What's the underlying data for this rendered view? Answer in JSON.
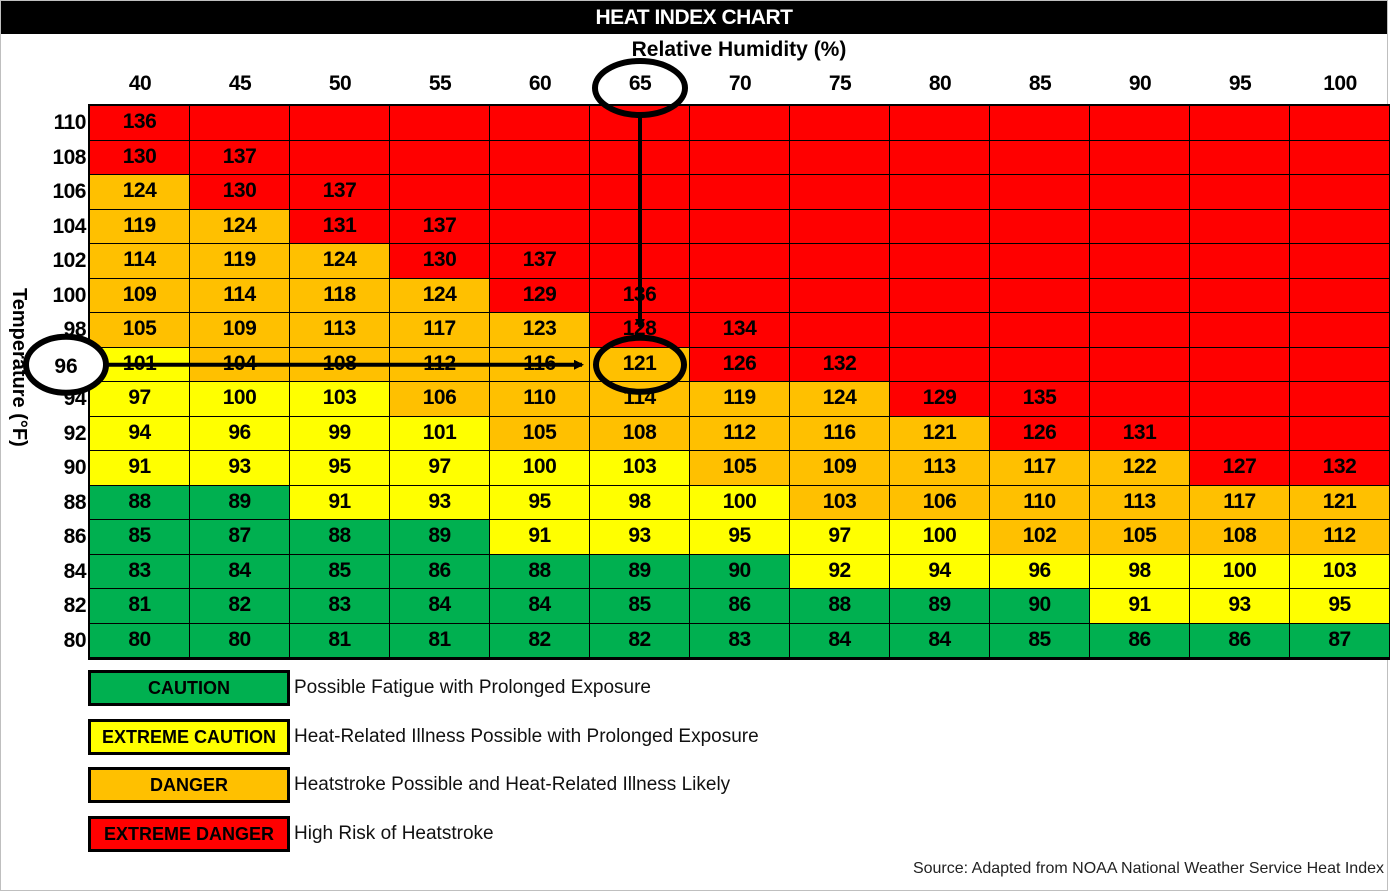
{
  "chart_data": {
    "type": "heatmap",
    "title": "HEAT INDEX CHART",
    "xlabel": "Relative Humidity (%)",
    "ylabel": "Temperature (°F)",
    "x": [
      40,
      45,
      50,
      55,
      60,
      65,
      70,
      75,
      80,
      85,
      90,
      95,
      100
    ],
    "y": [
      110,
      108,
      106,
      104,
      102,
      100,
      98,
      96,
      94,
      92,
      90,
      88,
      86,
      84,
      82,
      80
    ],
    "values": [
      [
        136,
        null,
        null,
        null,
        null,
        null,
        null,
        null,
        null,
        null,
        null,
        null,
        null
      ],
      [
        130,
        137,
        null,
        null,
        null,
        null,
        null,
        null,
        null,
        null,
        null,
        null,
        null
      ],
      [
        124,
        130,
        137,
        null,
        null,
        null,
        null,
        null,
        null,
        null,
        null,
        null,
        null
      ],
      [
        119,
        124,
        131,
        137,
        null,
        null,
        null,
        null,
        null,
        null,
        null,
        null,
        null
      ],
      [
        114,
        119,
        124,
        130,
        137,
        null,
        null,
        null,
        null,
        null,
        null,
        null,
        null
      ],
      [
        109,
        114,
        118,
        124,
        129,
        136,
        null,
        null,
        null,
        null,
        null,
        null,
        null
      ],
      [
        105,
        109,
        113,
        117,
        123,
        128,
        134,
        null,
        null,
        null,
        null,
        null,
        null
      ],
      [
        101,
        104,
        108,
        112,
        116,
        121,
        126,
        132,
        null,
        null,
        null,
        null,
        null
      ],
      [
        97,
        100,
        103,
        106,
        110,
        114,
        119,
        124,
        129,
        135,
        null,
        null,
        null
      ],
      [
        94,
        96,
        99,
        101,
        105,
        108,
        112,
        116,
        121,
        126,
        131,
        null,
        null
      ],
      [
        91,
        93,
        95,
        97,
        100,
        103,
        105,
        109,
        113,
        117,
        122,
        127,
        132
      ],
      [
        88,
        89,
        91,
        93,
        95,
        98,
        100,
        103,
        106,
        110,
        113,
        117,
        121
      ],
      [
        85,
        87,
        88,
        89,
        91,
        93,
        95,
        97,
        100,
        102,
        105,
        108,
        112
      ],
      [
        83,
        84,
        85,
        86,
        88,
        89,
        90,
        92,
        94,
        96,
        98,
        100,
        103
      ],
      [
        81,
        82,
        83,
        84,
        84,
        85,
        86,
        88,
        89,
        90,
        91,
        93,
        95
      ],
      [
        80,
        80,
        81,
        81,
        82,
        82,
        83,
        84,
        84,
        85,
        86,
        86,
        87
      ]
    ],
    "categories_by_cell": [
      [
        "ED",
        "ED",
        "ED",
        "ED",
        "ED",
        "ED",
        "ED",
        "ED",
        "ED",
        "ED",
        "ED",
        "ED",
        "ED"
      ],
      [
        "ED",
        "ED",
        "ED",
        "ED",
        "ED",
        "ED",
        "ED",
        "ED",
        "ED",
        "ED",
        "ED",
        "ED",
        "ED"
      ],
      [
        "D",
        "ED",
        "ED",
        "ED",
        "ED",
        "ED",
        "ED",
        "ED",
        "ED",
        "ED",
        "ED",
        "ED",
        "ED"
      ],
      [
        "D",
        "D",
        "ED",
        "ED",
        "ED",
        "ED",
        "ED",
        "ED",
        "ED",
        "ED",
        "ED",
        "ED",
        "ED"
      ],
      [
        "D",
        "D",
        "D",
        "ED",
        "ED",
        "ED",
        "ED",
        "ED",
        "ED",
        "ED",
        "ED",
        "ED",
        "ED"
      ],
      [
        "D",
        "D",
        "D",
        "D",
        "ED",
        "ED",
        "ED",
        "ED",
        "ED",
        "ED",
        "ED",
        "ED",
        "ED"
      ],
      [
        "D",
        "D",
        "D",
        "D",
        "D",
        "ED",
        "ED",
        "ED",
        "ED",
        "ED",
        "ED",
        "ED",
        "ED"
      ],
      [
        "EC",
        "D",
        "D",
        "D",
        "D",
        "D",
        "ED",
        "ED",
        "ED",
        "ED",
        "ED",
        "ED",
        "ED"
      ],
      [
        "EC",
        "EC",
        "EC",
        "D",
        "D",
        "D",
        "D",
        "D",
        "ED",
        "ED",
        "ED",
        "ED",
        "ED"
      ],
      [
        "EC",
        "EC",
        "EC",
        "EC",
        "D",
        "D",
        "D",
        "D",
        "D",
        "ED",
        "ED",
        "ED",
        "ED"
      ],
      [
        "EC",
        "EC",
        "EC",
        "EC",
        "EC",
        "EC",
        "D",
        "D",
        "D",
        "D",
        "D",
        "ED",
        "ED"
      ],
      [
        "C",
        "C",
        "EC",
        "EC",
        "EC",
        "EC",
        "EC",
        "D",
        "D",
        "D",
        "D",
        "D",
        "D"
      ],
      [
        "C",
        "C",
        "C",
        "C",
        "EC",
        "EC",
        "EC",
        "EC",
        "EC",
        "D",
        "D",
        "D",
        "D"
      ],
      [
        "C",
        "C",
        "C",
        "C",
        "C",
        "C",
        "C",
        "EC",
        "EC",
        "EC",
        "EC",
        "EC",
        "EC"
      ],
      [
        "C",
        "C",
        "C",
        "C",
        "C",
        "C",
        "C",
        "C",
        "C",
        "C",
        "EC",
        "EC",
        "EC"
      ],
      [
        "C",
        "C",
        "C",
        "C",
        "C",
        "C",
        "C",
        "C",
        "C",
        "C",
        "C",
        "C",
        "C"
      ]
    ],
    "legend": [
      {
        "key": "C",
        "label": "CAUTION",
        "description": "Possible Fatigue with Prolonged Exposure",
        "color": "#00b050"
      },
      {
        "key": "EC",
        "label": "EXTREME CAUTION",
        "description": "Heat-Related Illness Possible with Prolonged Exposure",
        "color": "#ffff00"
      },
      {
        "key": "D",
        "label": "DANGER",
        "description": "Heatstroke Possible and Heat-Related Illness Likely",
        "color": "#ffc000"
      },
      {
        "key": "ED",
        "label": "EXTREME DANGER",
        "description": "High Risk of Heatstroke",
        "color": "#ff0000"
      }
    ],
    "legend_placement": "bottom-left",
    "annotations": {
      "highlighted_temperature": 96,
      "highlighted_humidity": 65,
      "highlighted_value": 121,
      "note": "circles on 65% column header, 96°F row label and 121 cell, with arrows leading to the 121 cell"
    },
    "source": "Source: Adapted from NOAA National Weather Service Heat Index"
  }
}
